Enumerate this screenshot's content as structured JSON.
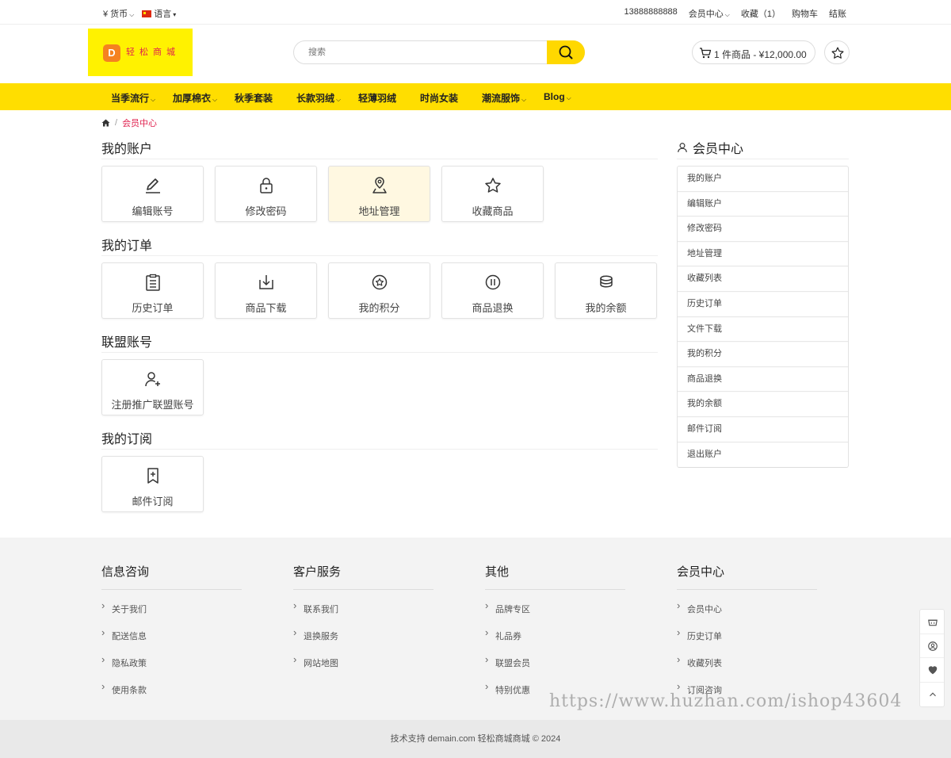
{
  "topbar": {
    "currency": "¥ 货币",
    "language": "语言",
    "phone": "13888888888",
    "member_center": "会员中心",
    "favorites": "收藏（1）",
    "cart": "购物车",
    "checkout": "结账"
  },
  "header": {
    "logo_mark": "D",
    "logo_text": "轻松商城",
    "search_placeholder": "搜索",
    "cart_summary": "1 件商品 - ¥12,000.00"
  },
  "nav": [
    {
      "label": "当季流行",
      "dropdown": true
    },
    {
      "label": "加厚棉衣",
      "dropdown": true
    },
    {
      "label": "秋季套装",
      "dropdown": false
    },
    {
      "label": "长款羽绒",
      "dropdown": true
    },
    {
      "label": "轻薄羽绒",
      "dropdown": false
    },
    {
      "label": "时尚女装",
      "dropdown": false
    },
    {
      "label": "潮流服饰",
      "dropdown": true
    },
    {
      "label": "Blog",
      "dropdown": true
    }
  ],
  "breadcrumb": {
    "current": "会员中心"
  },
  "sections": {
    "account": {
      "title": "我的账户",
      "tiles": [
        {
          "label": "编辑账号",
          "icon": "pencil-icon"
        },
        {
          "label": "修改密码",
          "icon": "lock-icon"
        },
        {
          "label": "地址管理",
          "icon": "location-pin-icon"
        },
        {
          "label": "收藏商品",
          "icon": "star-icon"
        }
      ]
    },
    "orders": {
      "title": "我的订单",
      "tiles": [
        {
          "label": "历史订单",
          "icon": "clipboard-list-icon"
        },
        {
          "label": "商品下载",
          "icon": "download-icon"
        },
        {
          "label": "我的积分",
          "icon": "points-badge-icon"
        },
        {
          "label": "商品退换",
          "icon": "return-icon"
        },
        {
          "label": "我的余额",
          "icon": "coins-stack-icon"
        }
      ]
    },
    "affiliate": {
      "title": "联盟账号",
      "tiles": [
        {
          "label": "注册推广联盟账号",
          "icon": "user-plus-icon"
        }
      ]
    },
    "subscription": {
      "title": "我的订阅",
      "tiles": [
        {
          "label": "邮件订阅",
          "icon": "bookmark-plus-icon"
        }
      ]
    }
  },
  "sidebar": {
    "title": "会员中心",
    "items": [
      "我的账户",
      "编辑账户",
      "修改密码",
      "地址管理",
      "收藏列表",
      "历史订单",
      "文件下载",
      "我的积分",
      "商品退换",
      "我的余额",
      "邮件订阅",
      "退出账户"
    ]
  },
  "footer": {
    "columns": [
      {
        "title": "信息咨询",
        "links": [
          "关于我们",
          "配送信息",
          "隐私政策",
          "使用条款"
        ]
      },
      {
        "title": "客户服务",
        "links": [
          "联系我们",
          "退换服务",
          "网站地图"
        ]
      },
      {
        "title": "其他",
        "links": [
          "品牌专区",
          "礼品券",
          "联盟会员",
          "特别优惠"
        ]
      },
      {
        "title": "会员中心",
        "links": [
          "会员中心",
          "历史订单",
          "收藏列表",
          "订阅咨询"
        ]
      }
    ],
    "copyright": "技术支持 demain.com 轻松商城商城 © 2024"
  },
  "watermark": "https://www.huzhan.com/ishop43604",
  "colors": {
    "accent": "#ffde00",
    "breadcrumb_active": "#e0224f",
    "active_tile": "#fff8e1"
  }
}
